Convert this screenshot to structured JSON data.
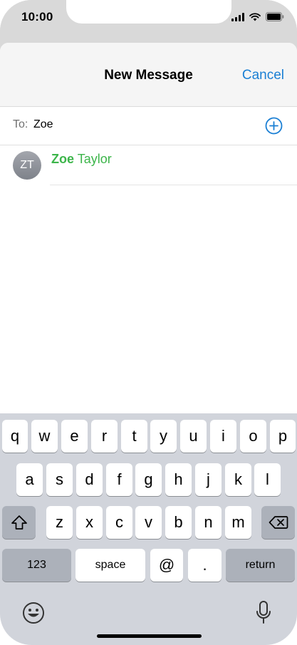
{
  "status_bar": {
    "time": "10:00"
  },
  "nav": {
    "title": "New Message",
    "cancel_label": "Cancel"
  },
  "recipient": {
    "label": "To:",
    "value": "Zoe"
  },
  "suggestion": {
    "initials": "ZT",
    "match": "Zoe",
    "rest": " Taylor"
  },
  "colors": {
    "accent": "#1a7fd4",
    "match_green": "#3cb54a"
  },
  "keyboard": {
    "row1": [
      "q",
      "w",
      "e",
      "r",
      "t",
      "y",
      "u",
      "i",
      "o",
      "p"
    ],
    "row2": [
      "a",
      "s",
      "d",
      "f",
      "g",
      "h",
      "j",
      "k",
      "l"
    ],
    "row3": [
      "z",
      "x",
      "c",
      "v",
      "b",
      "n",
      "m"
    ],
    "numbers_label": "123",
    "space_label": "space",
    "at_label": "@",
    "dot_label": ".",
    "return_label": "return",
    "icons": [
      "shift-icon",
      "backspace-icon",
      "emoji-icon",
      "microphone-icon"
    ]
  }
}
